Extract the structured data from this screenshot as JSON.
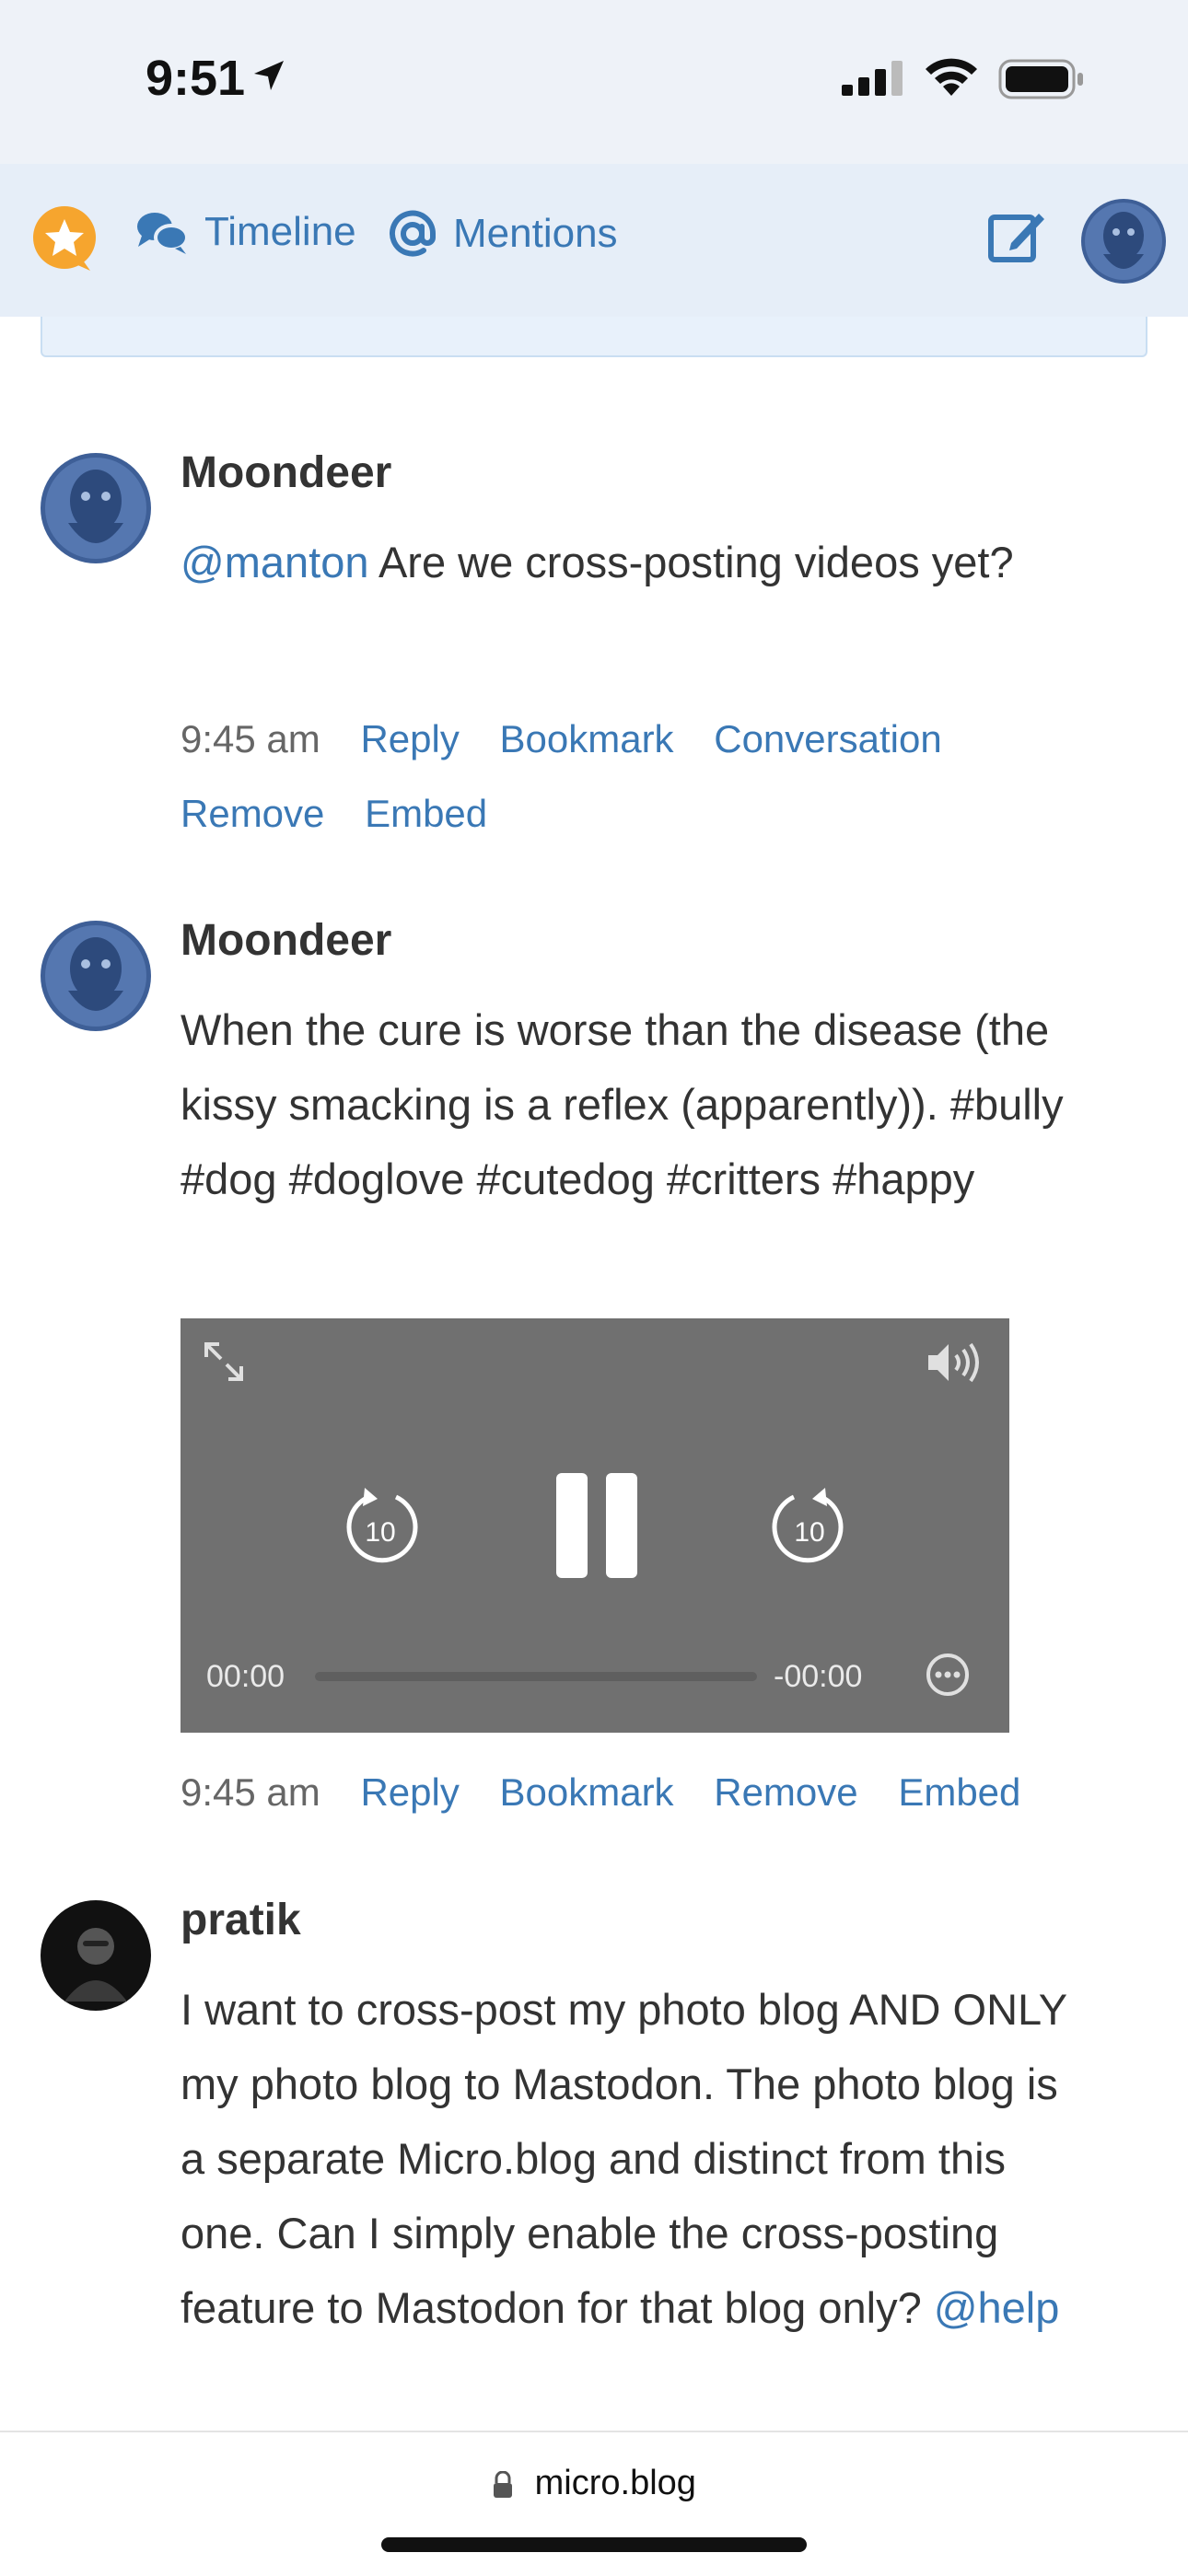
{
  "status_bar": {
    "time": "9:51"
  },
  "nav": {
    "timeline_label": "Timeline",
    "mentions_label": "Mentions"
  },
  "posts": [
    {
      "author": "Moondeer",
      "mention": "@manton",
      "text": "Are we cross-posting videos yet?",
      "time": "9:45 am",
      "actions": [
        "Reply",
        "Bookmark",
        "Conversation",
        "Remove",
        "Embed"
      ]
    },
    {
      "author": "Moondeer",
      "text": "When the cure is worse than the disease (the kissy smacking is a reflex (apparently)). #bully #dog #doglove #cutedog #critters #happy",
      "video": {
        "current_time": "00:00",
        "remaining_time": "-00:00",
        "progress": 0
      },
      "time": "9:45 am",
      "actions": [
        "Reply",
        "Bookmark",
        "Remove",
        "Embed"
      ]
    },
    {
      "author": "pratik",
      "text": "I want to cross-post my photo blog AND ONLY my photo blog to Mastodon. The photo blog is a separate Micro.blog and distinct from this one. Can I simply enable the cross-posting feature to Mastodon for that blog only?",
      "mention": "@help"
    }
  ],
  "url_bar": {
    "domain": "micro.blog"
  },
  "colors": {
    "accent": "#3a78b5",
    "text": "#333333",
    "video_bg": "#707070"
  }
}
